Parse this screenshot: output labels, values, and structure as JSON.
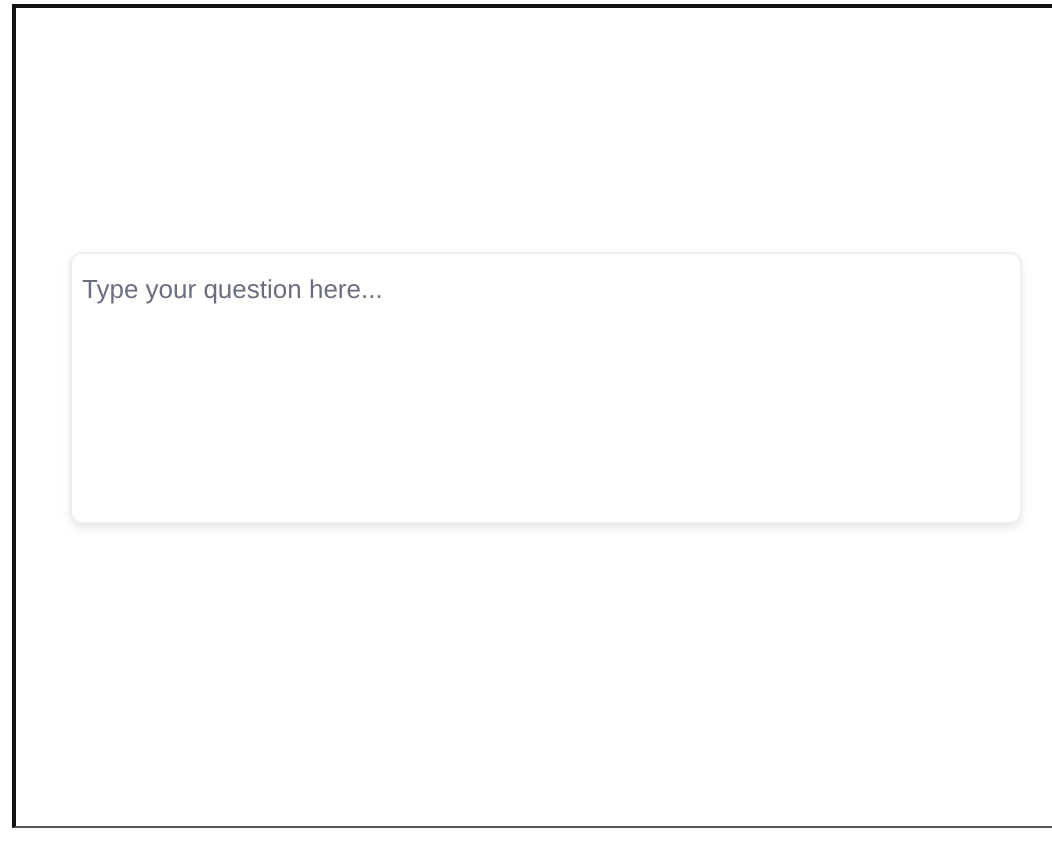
{
  "question_field": {
    "placeholder": "Type your question here..."
  }
}
